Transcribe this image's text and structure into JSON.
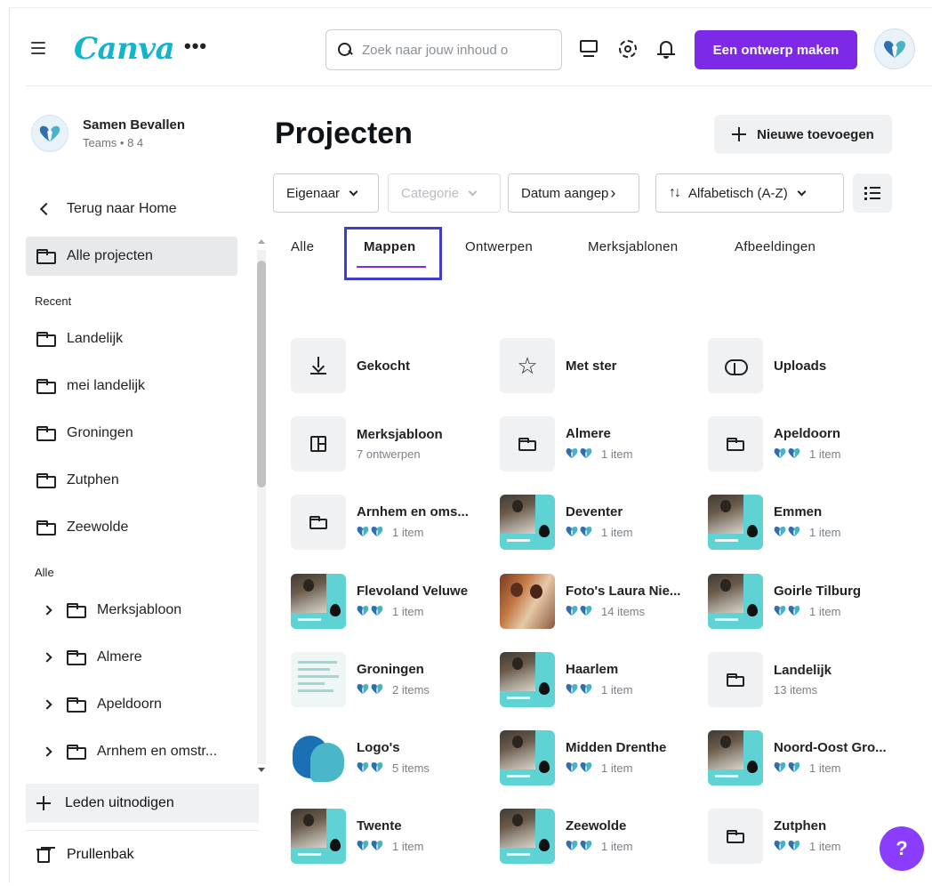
{
  "app": {
    "logo_text": "Canva",
    "more_label": "•••",
    "brand_color": "#7d2ae8",
    "logo_color": "#12b5cb"
  },
  "search": {
    "placeholder": "Zoek naar jouw inhoud o",
    "value": ""
  },
  "header": {
    "create_button": "Een ontwerp maken",
    "icons": [
      "desktop-icon",
      "gear-icon",
      "bell-icon"
    ]
  },
  "sidebar": {
    "team_name": "Samen Bevallen",
    "team_sub": "Teams • 8 4",
    "back_home": "Terug naar Home",
    "all_projects": "Alle projecten",
    "recent_label": "Recent",
    "recent": [
      {
        "label": "Landelijk"
      },
      {
        "label": "mei landelijk"
      },
      {
        "label": "Groningen"
      },
      {
        "label": "Zutphen"
      },
      {
        "label": "Zeewolde"
      }
    ],
    "all_label": "Alle",
    "folders": [
      {
        "label": "Merksjabloon"
      },
      {
        "label": "Almere"
      },
      {
        "label": "Apeldoorn"
      },
      {
        "label": "Arnhem en omstr..."
      }
    ],
    "invite": "Leden uitnodigen",
    "trash": "Prullenbak"
  },
  "main": {
    "title": "Projecten",
    "add_button": "Nieuwe toevoegen",
    "filters": {
      "owner": "Eigenaar",
      "category": "Categorie",
      "date": "Datum aangep",
      "sort": "Alfabetisch (A-Z)",
      "sort_icon": "↑↓"
    },
    "tabs": [
      {
        "label": "Alle"
      },
      {
        "label": "Mappen"
      },
      {
        "label": "Ontwerpen"
      },
      {
        "label": "Merksjablonen"
      },
      {
        "label": "Afbeeldingen"
      }
    ],
    "active_tab": "Mappen",
    "items": [
      {
        "title": "Gekocht",
        "sub": "",
        "icon": "download-icon"
      },
      {
        "title": "Met ster",
        "sub": "",
        "icon": "star-icon"
      },
      {
        "title": "Uploads",
        "sub": "",
        "icon": "cloud-upload-icon"
      },
      {
        "title": "Merksjabloon",
        "sub": "7 ontwerpen",
        "icon": "template-icon"
      },
      {
        "title": "Almere",
        "sub": "1 item",
        "icon": "folder-icon"
      },
      {
        "title": "Apeldoorn",
        "sub": "1 item",
        "icon": "folder-icon"
      },
      {
        "title": "Arnhem en oms...",
        "sub": "1 item",
        "icon": "folder-icon"
      },
      {
        "title": "Deventer",
        "sub": "1 item",
        "icon": "photo-thumbnail"
      },
      {
        "title": "Emmen",
        "sub": "1 item",
        "icon": "photo-thumbnail"
      },
      {
        "title": "Flevoland Veluwe",
        "sub": "1 item",
        "icon": "photo-thumbnail"
      },
      {
        "title": "Foto's Laura Nie...",
        "sub": "14 items",
        "icon": "duo-photo-thumbnail"
      },
      {
        "title": "Goirle Tilburg",
        "sub": "1 item",
        "icon": "photo-thumbnail"
      },
      {
        "title": "Groningen",
        "sub": "2 items",
        "icon": "document-thumbnail"
      },
      {
        "title": "Haarlem",
        "sub": "1 item",
        "icon": "photo-thumbnail"
      },
      {
        "title": "Landelijk",
        "sub": "13 items",
        "icon": "folder-icon"
      },
      {
        "title": "Logo's",
        "sub": "5 items",
        "icon": "logo-thumbnail"
      },
      {
        "title": "Midden Drenthe",
        "sub": "1 item",
        "icon": "photo-thumbnail"
      },
      {
        "title": "Noord-Oost Gro...",
        "sub": "1 item",
        "icon": "photo-thumbnail"
      },
      {
        "title": "Twente",
        "sub": "1 item",
        "icon": "photo-thumbnail"
      },
      {
        "title": "Zeewolde",
        "sub": "1 item",
        "icon": "photo-thumbnail"
      },
      {
        "title": "Zutphen",
        "sub": "1 item",
        "icon": "folder-icon"
      }
    ]
  },
  "help_label": "?"
}
